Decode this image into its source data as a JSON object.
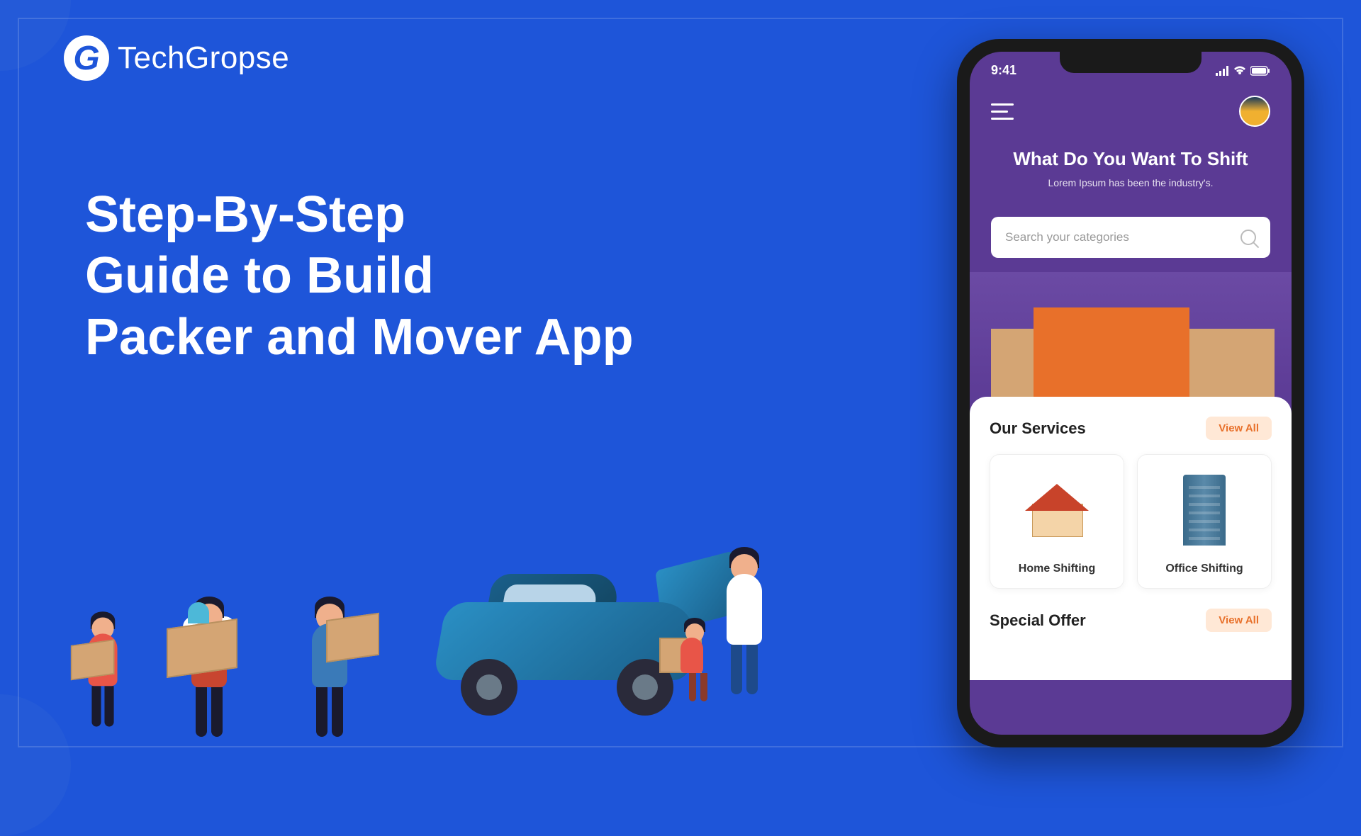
{
  "brand": {
    "logo_letter": "G",
    "name": "TechGropse"
  },
  "heading": {
    "line1": "Step-By-Step",
    "line2": "Guide to Build",
    "line3": "Packer and Mover App"
  },
  "phone": {
    "status": {
      "time": "9:41"
    },
    "hero": {
      "title": "What Do You Want To Shift",
      "subtitle": "Lorem Ipsum has been the industry's."
    },
    "search": {
      "placeholder": "Search your categories"
    },
    "sections": [
      {
        "title": "Our Services",
        "link": "View All",
        "items": [
          {
            "label": "Home Shifting"
          },
          {
            "label": "Office Shifting"
          }
        ]
      },
      {
        "title": "Special Offer",
        "link": "View All"
      }
    ]
  }
}
